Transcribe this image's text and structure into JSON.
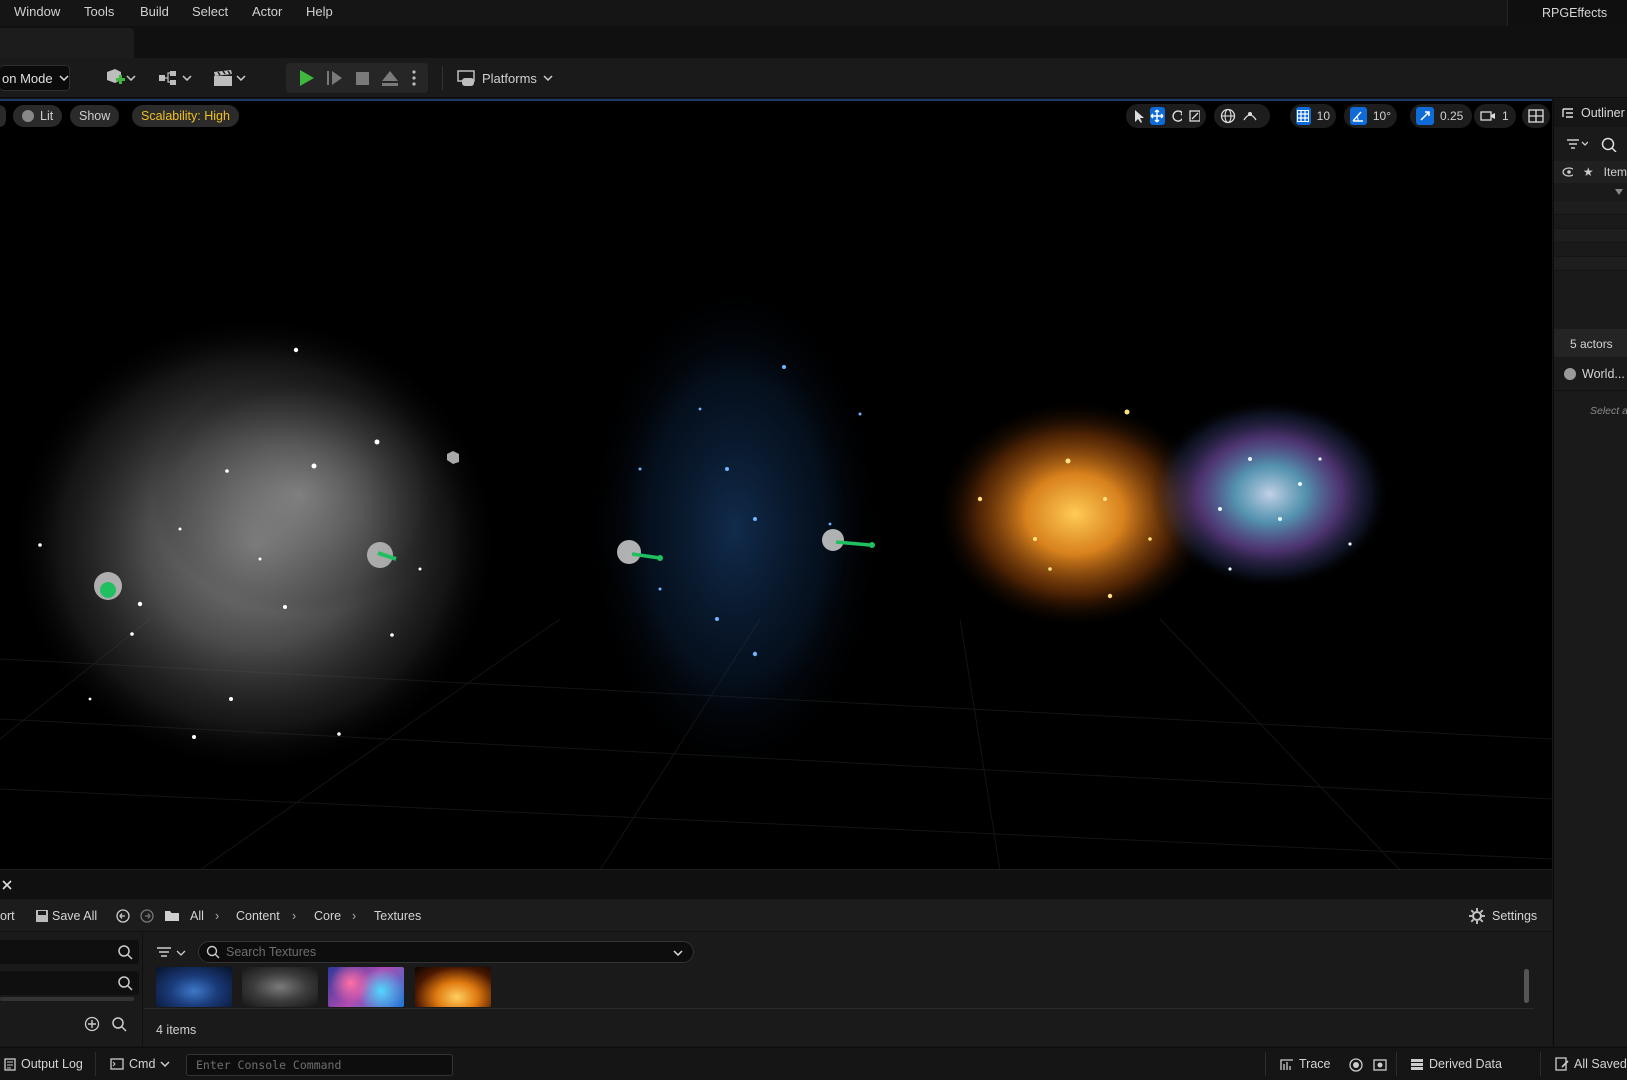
{
  "menu": {
    "items": [
      "Window",
      "Tools",
      "Build",
      "Select",
      "Actor",
      "Help"
    ],
    "project_name": "RPGEffects"
  },
  "toolbar": {
    "mode_label": "on Mode",
    "platforms_label": "Platforms"
  },
  "viewport": {
    "lit_label": "Lit",
    "show_label": "Show",
    "scalability_label": "Scalability: High",
    "grid_snap": "10",
    "rotation_snap": "10°",
    "scale_snap": "0.25",
    "camera_speed": "1"
  },
  "outliner": {
    "title": "Outliner",
    "item_header": "Item",
    "actors_count": "5 actors",
    "world_label": "World...",
    "select_hint": "Select a"
  },
  "content_browser": {
    "import_label": "ort",
    "save_all_label": "Save All",
    "breadcrumb": [
      "All",
      "Content",
      "Core",
      "Textures"
    ],
    "settings_label": "Settings",
    "search_placeholder": "Search Textures",
    "items_count": "4 items",
    "thumbnails": [
      "blue-smoke-texture",
      "grey-smoke-texture",
      "nebula-texture",
      "fire-texture"
    ]
  },
  "statusbar": {
    "output_log_label": "Output Log",
    "cmd_label": "Cmd",
    "console_placeholder": "Enter Console Command",
    "trace_label": "Trace",
    "derived_data_label": "Derived Data",
    "all_saved_label": "All Saved"
  },
  "colors": {
    "accent_blue": "#0e6bd8",
    "scalability_yellow": "#f0c020",
    "play_green": "#3fb83f"
  }
}
